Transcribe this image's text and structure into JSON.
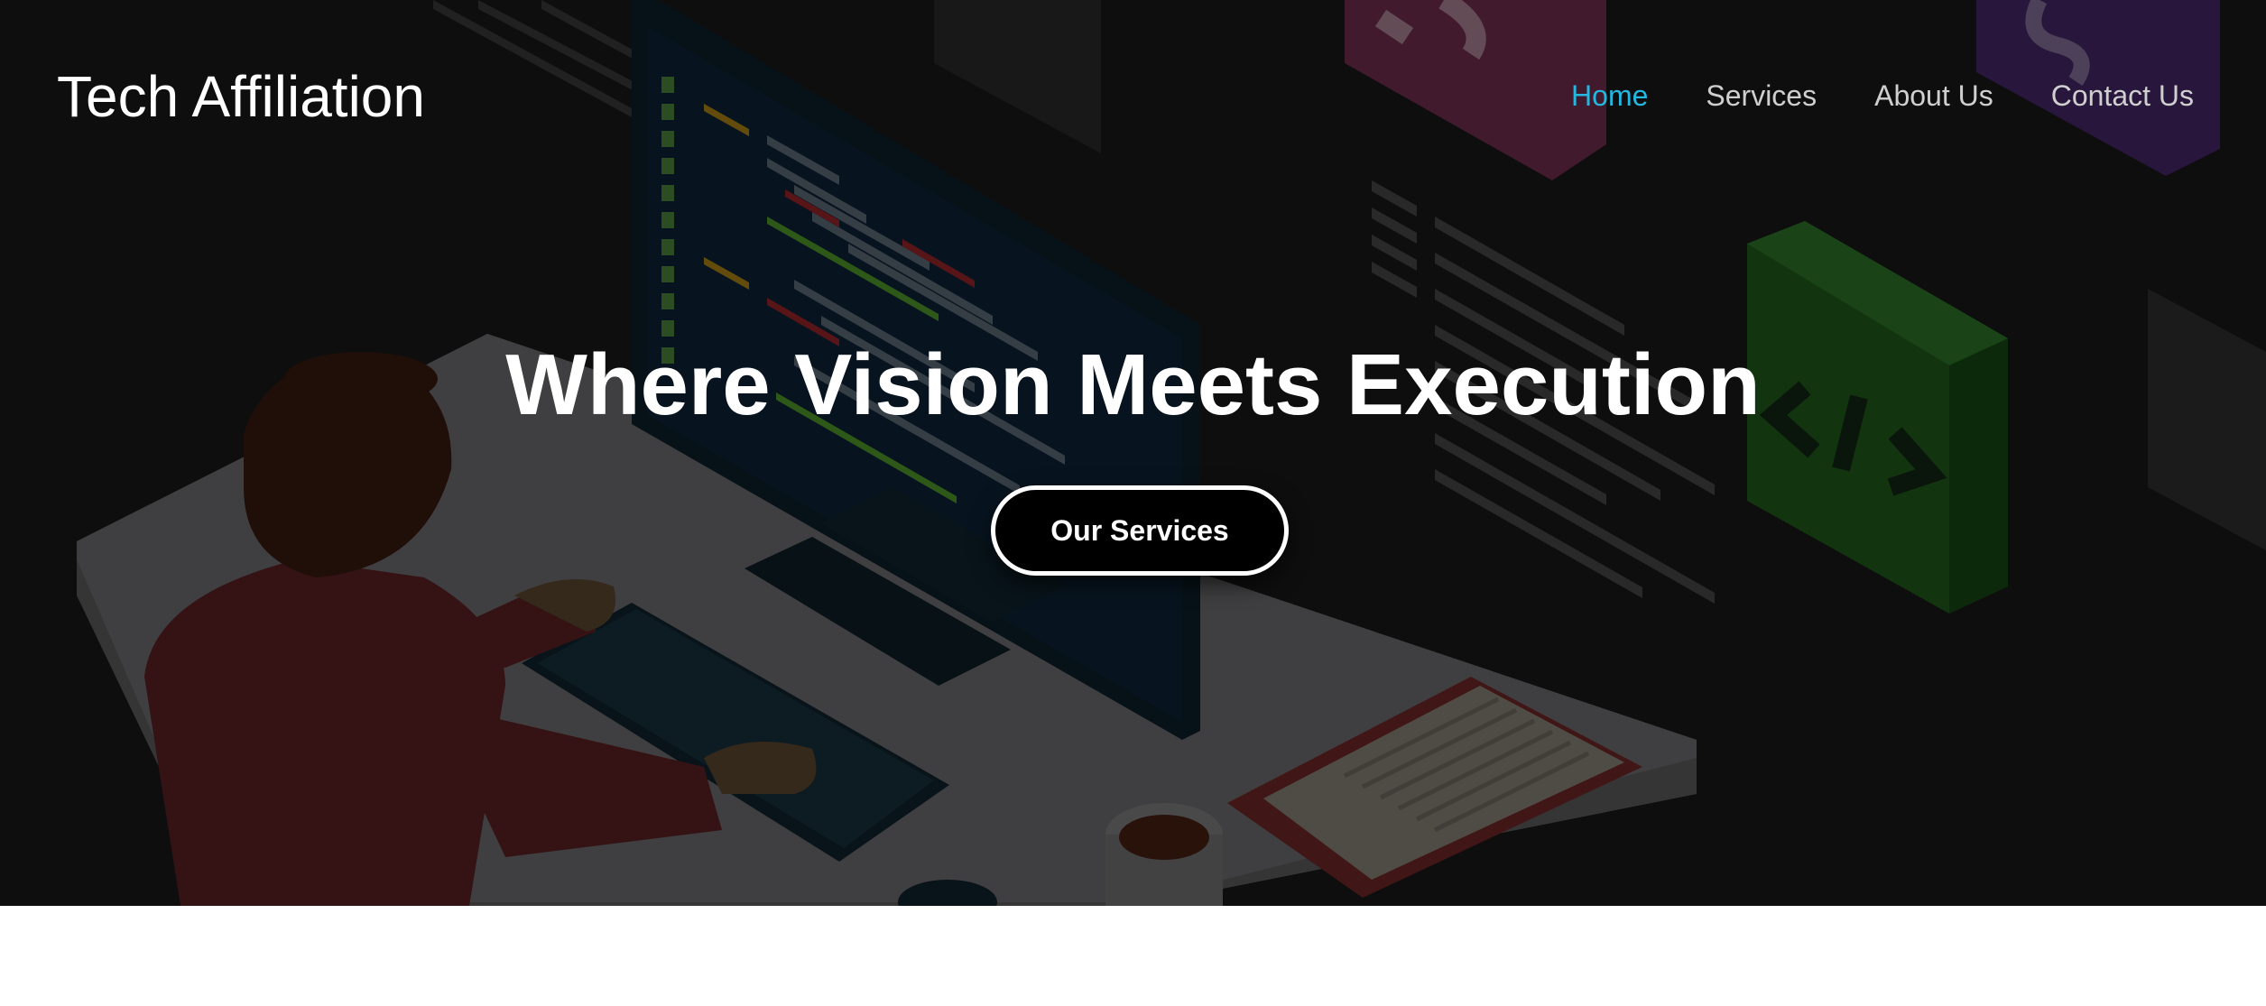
{
  "header": {
    "brand": "Tech Affiliation",
    "nav": [
      {
        "label": "Home",
        "active": true
      },
      {
        "label": "Services",
        "active": false
      },
      {
        "label": "About Us",
        "active": false
      },
      {
        "label": "Contact Us",
        "active": false
      }
    ]
  },
  "hero": {
    "headline": "Where Vision Meets Execution",
    "cta_label": "Our Services",
    "illustration": "developer-at-desk-illustration"
  },
  "colors": {
    "nav_active": "#22b8e0",
    "nav_default": "#cfcfcf",
    "hero_background": "#141414",
    "cta_background": "#000000"
  }
}
